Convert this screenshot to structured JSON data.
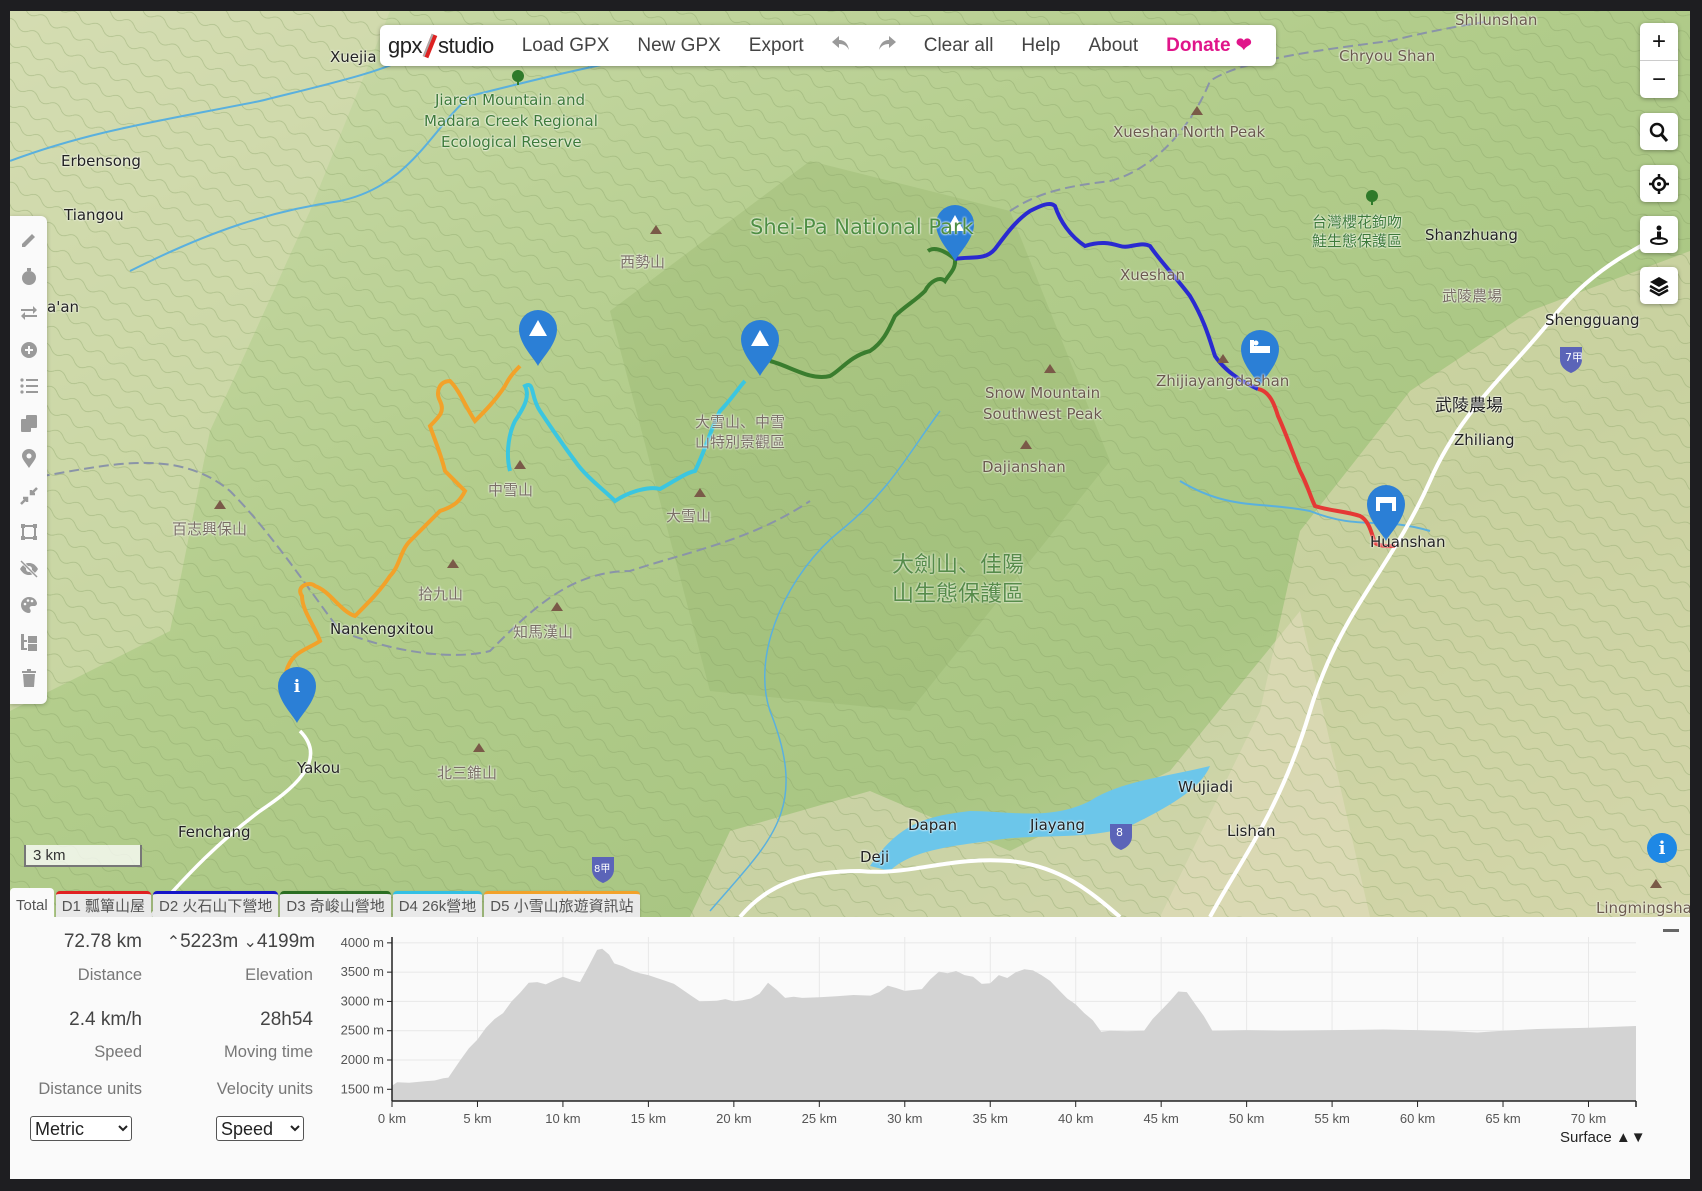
{
  "app": {
    "logo_left": "gpx",
    "logo_right": "studio"
  },
  "menu": {
    "load": "Load GPX",
    "new": "New GPX",
    "export": "Export",
    "undo_icon": "undo-icon",
    "redo_icon": "redo-icon",
    "clear": "Clear all",
    "help": "Help",
    "about": "About",
    "donate": "Donate",
    "donate_color": "#e0158a"
  },
  "map_controls": {
    "zoom_in": "+",
    "zoom_out": "−",
    "search_icon": "search-icon",
    "locate_icon": "crosshair-icon",
    "streetview_icon": "person-pin-icon",
    "layers_icon": "layers-icon"
  },
  "left_tools": [
    "pencil-icon",
    "stopwatch-icon",
    "reverse-icon",
    "plus-circle-icon",
    "list-icon",
    "copy-icon",
    "map-pin-icon",
    "compress-icon",
    "crop-icon",
    "eye-slash-icon",
    "palette-icon",
    "folder-tree-icon",
    "trash-icon"
  ],
  "map": {
    "scale_label": "3 km",
    "labels": {
      "xuejia": "Xuejia",
      "jiaren": "Jiaren Mountain and",
      "madara": "Madara Creek Regional",
      "ecological": "Ecological Reserve",
      "erbensong": "Erbensong",
      "tiangou": "Tiangou",
      "aan": "a'an",
      "xishi": "西勢山",
      "sheipa": "Shei-Pa National Park",
      "xueshan_north": "Xueshan North Peak",
      "chryou": "Chryou Shan",
      "shilunshan": "Shilunshan",
      "xueshan": "Xueshan",
      "tw_reserve1": "台灣櫻花鉤吻",
      "tw_reserve2": "鮭生態保護區",
      "shanzhuang": "Shanzhuang",
      "wuling_small": "武陵農場",
      "shengguang": "Shengguang",
      "route7": "7甲",
      "wuling_big": "武陵農場",
      "zhiliang": "Zhiliang",
      "zhijia": "Zhijiayangdashan",
      "huanshan": "Huanshan",
      "snow_sw1": "Snow Mountain",
      "snow_sw2": "Southwest Peak",
      "dajianshan": "Dajianshan",
      "daxue_area1": "大雪山、中雪",
      "daxue_area2": "山特別景觀區",
      "zhongxue": "中雪山",
      "daxue": "大雪山",
      "baizhi": "百志興保山",
      "shijiu": "拾九山",
      "zhima": "知馬漢山",
      "nankeng": "Nankengxitou",
      "dajian_reserve1": "大劍山、佳陽",
      "dajian_reserve2": "山生態保護區",
      "yakou": "Yakou",
      "beisan": "北三錐山",
      "fenchang": "Fenchang",
      "dapan": "Dapan",
      "jiayang": "Jiayang",
      "wujiadi": "Wujiadi",
      "lishan": "Lishan",
      "deji": "Deji",
      "route8": "8",
      "route8a": "8甲",
      "lingming": "Lingmingsha"
    },
    "tracks": [
      {
        "name": "D1",
        "color": "#e53935"
      },
      {
        "name": "D2",
        "color": "#2a2ad0"
      },
      {
        "name": "D3",
        "color": "#3a7d2e"
      },
      {
        "name": "D4",
        "color": "#3bc6e0"
      },
      {
        "name": "D5",
        "color": "#f2a22a"
      }
    ]
  },
  "tabs": [
    {
      "label": "Total",
      "color": ""
    },
    {
      "label": "D1 瓢簞山屋",
      "color": "#e02020"
    },
    {
      "label": "D2 火石山下營地",
      "color": "#1515c8"
    },
    {
      "label": "D3 奇峻山營地",
      "color": "#2a6e22"
    },
    {
      "label": "D4 26k營地",
      "color": "#33c0e4"
    },
    {
      "label": "D5 小雪山旅遊資訊站",
      "color": "#f2a22a"
    }
  ],
  "stats": {
    "distance_value": "72.78 km",
    "distance_label": "Distance",
    "elev_up": "5223m",
    "elev_down": "4199m",
    "elevation_label": "Elevation",
    "speed_value": "2.4 km/h",
    "speed_label": "Speed",
    "moving_value": "28h54",
    "moving_label": "Moving time",
    "dist_units_label": "Distance units",
    "vel_units_label": "Velocity units",
    "dist_units_selected": "Metric",
    "vel_units_selected": "Speed"
  },
  "chart_data": {
    "type": "area",
    "title": "",
    "xlabel": "",
    "ylabel": "",
    "xlim": [
      0,
      72.78
    ],
    "ylim": [
      1300,
      4100
    ],
    "x_ticks": [
      "0 km",
      "5 km",
      "10 km",
      "15 km",
      "20 km",
      "25 km",
      "30 km",
      "35 km",
      "40 km",
      "45 km",
      "50 km",
      "55 km",
      "60 km",
      "65 km",
      "70 km"
    ],
    "x_tick_values": [
      0,
      5,
      10,
      15,
      20,
      25,
      30,
      35,
      40,
      45,
      50,
      55,
      60,
      65,
      70
    ],
    "y_ticks": [
      "1500 m",
      "2000 m",
      "2500 m",
      "3000 m",
      "3500 m",
      "4000 m"
    ],
    "y_tick_values": [
      1500,
      2000,
      2500,
      3000,
      3500,
      4000
    ],
    "grid": true,
    "series": [
      {
        "name": "Elevation",
        "x": [
          0,
          0.3,
          1,
          2,
          2.5,
          3,
          3.3,
          4,
          4.5,
          5,
          5.5,
          6,
          6.5,
          7,
          7.5,
          8,
          8.5,
          9,
          9.5,
          10,
          10.5,
          11,
          11.5,
          12,
          12.3,
          12.7,
          13,
          13.5,
          14,
          14.5,
          15,
          15.5,
          16,
          16.5,
          17,
          17.5,
          18,
          19,
          19.5,
          20,
          20.5,
          21,
          21.5,
          22,
          22.5,
          23,
          23.5,
          24,
          25,
          26,
          27,
          28,
          28.5,
          29,
          29.5,
          30,
          31,
          31.5,
          32,
          32.5,
          33,
          33.5,
          34,
          34.5,
          35,
          35.5,
          36,
          36.5,
          37,
          37.5,
          38,
          38.5,
          39,
          39.5,
          40,
          40.5,
          41,
          41.5,
          42,
          43,
          44,
          44.5,
          45,
          45.5,
          46,
          46.5,
          47,
          47.5,
          48,
          50,
          52,
          55,
          58,
          60,
          62,
          63.5,
          65,
          67,
          70,
          72.78
        ],
        "values": [
          1560,
          1620,
          1610,
          1640,
          1650,
          1690,
          1700,
          2000,
          2200,
          2350,
          2550,
          2700,
          2800,
          3000,
          3150,
          3320,
          3330,
          3290,
          3360,
          3420,
          3370,
          3330,
          3600,
          3880,
          3900,
          3800,
          3650,
          3600,
          3530,
          3480,
          3450,
          3400,
          3350,
          3300,
          3200,
          3100,
          3000,
          3010,
          3040,
          3000,
          3020,
          3050,
          3130,
          3320,
          3200,
          3060,
          3080,
          3060,
          3070,
          3090,
          3110,
          3100,
          3160,
          3270,
          3230,
          3180,
          3210,
          3380,
          3510,
          3480,
          3520,
          3450,
          3420,
          3300,
          3310,
          3450,
          3400,
          3500,
          3550,
          3530,
          3450,
          3350,
          3200,
          3050,
          2950,
          2800,
          2680,
          2480,
          2500,
          2490,
          2500,
          2700,
          2850,
          3000,
          3170,
          3160,
          2950,
          2750,
          2500,
          2510,
          2500,
          2510,
          2520,
          2510,
          2490,
          2470,
          2500,
          2530,
          2550,
          2580
        ]
      }
    ],
    "legend": "none",
    "extra_label": "Surface"
  }
}
